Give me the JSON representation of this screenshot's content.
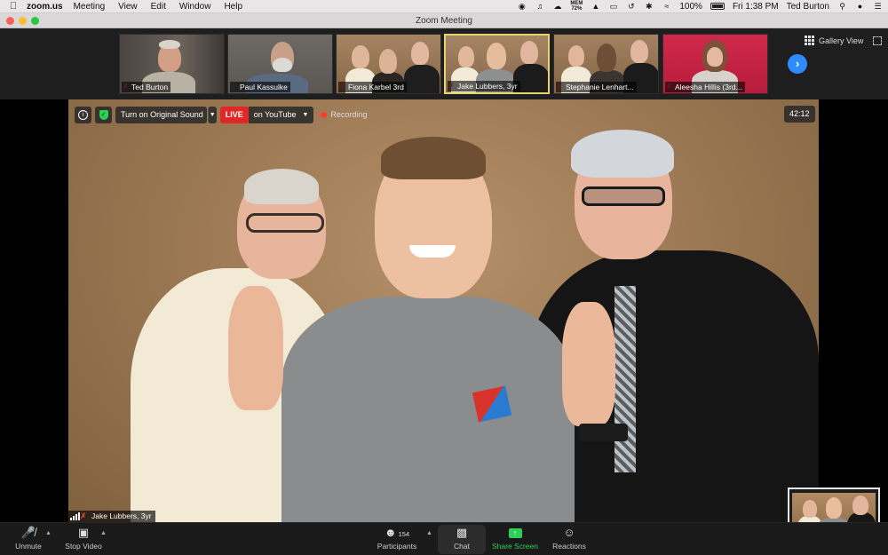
{
  "menubar": {
    "app_name": "zoom.us",
    "menus": [
      "Meeting",
      "View",
      "Edit",
      "Window",
      "Help"
    ],
    "memory_label": "MEM",
    "memory_value": "72%",
    "battery": "100%",
    "clock": "Fri 1:38 PM",
    "user": "Ted Burton"
  },
  "window": {
    "title": "Zoom Meeting"
  },
  "thumbnails": [
    {
      "name": "Ted Burton"
    },
    {
      "name": "Paul Kassulke"
    },
    {
      "name": "Fiona Karbel 3rd"
    },
    {
      "name": "Jake Lubbers, 3yr"
    },
    {
      "name": "Stephanie Lenhart..."
    },
    {
      "name": "Aleesha Hillis (3rd..."
    }
  ],
  "gallery_view_label": "Gallery View",
  "overlay": {
    "original_sound": "Turn on Original Sound",
    "live": "LIVE",
    "platform": "on YouTube",
    "recording": "Recording",
    "timer": "42:12"
  },
  "speaker": {
    "name": "Jake Lubbers, 3yr"
  },
  "toolbar": {
    "unmute": "Unmute",
    "stop_video": "Stop Video",
    "participants": "Participants",
    "participants_count": "154",
    "chat": "Chat",
    "share_screen": "Share Screen",
    "reactions": "Reactions"
  },
  "colors": {
    "accent_blue": "#2d8cff",
    "live_red": "#e02828",
    "share_green": "#2bd155",
    "active_speaker_border": "#e3d46d"
  }
}
